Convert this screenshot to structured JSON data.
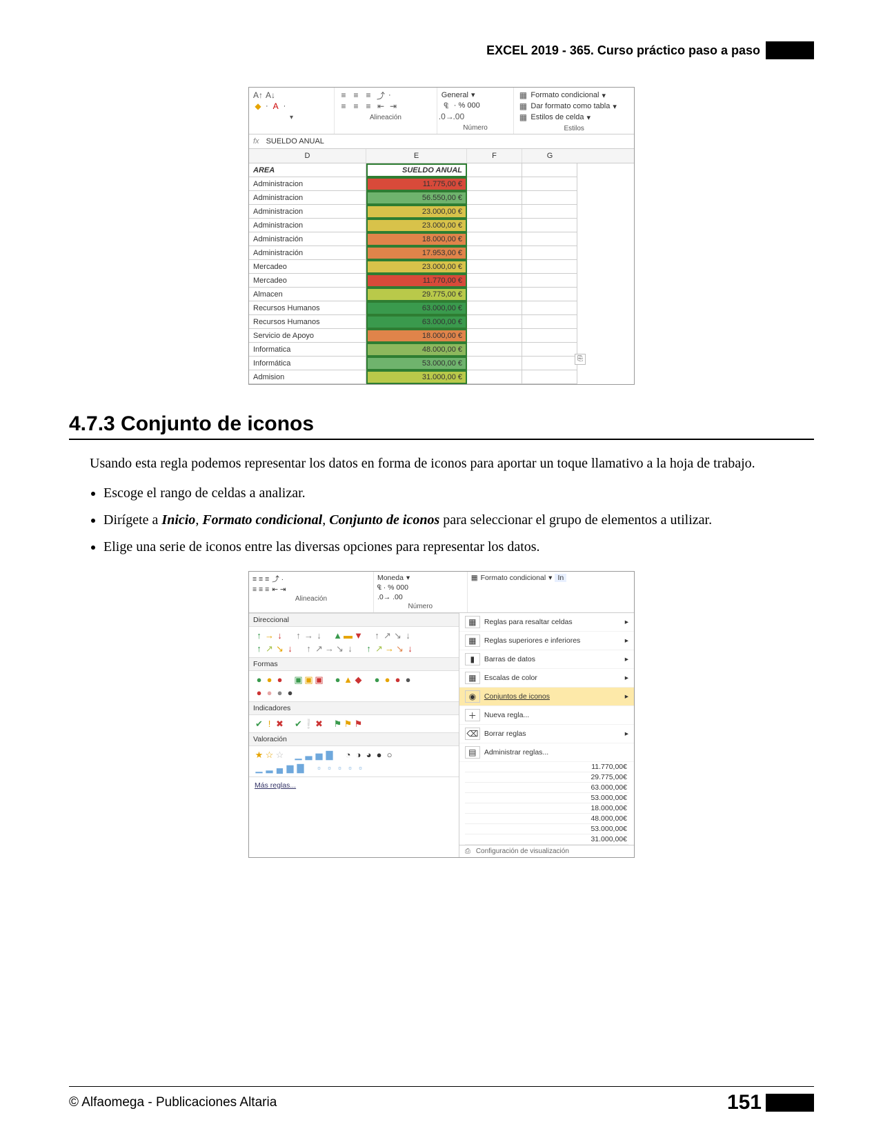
{
  "header": {
    "title": "EXCEL 2019 - 365. Curso práctico paso a paso"
  },
  "figure1": {
    "ribbon": {
      "font_group": {},
      "alignment_label": "Alineación",
      "number_format": "General",
      "number_label": "Número",
      "styles_label": "Estilos",
      "btn_cond": "Formato condicional",
      "btn_table": "Dar formato como tabla",
      "btn_cell": "Estilos de celda"
    },
    "formula_bar": {
      "fx": "fx",
      "value": "SUELDO ANUAL"
    },
    "columns": {
      "d": "D",
      "e": "E",
      "f": "F",
      "g": "G"
    },
    "headers": {
      "area": "AREA",
      "sueldo": "SUELDO ANUAL"
    },
    "rows": [
      {
        "area": "Administracion",
        "val": "11.775,00 €",
        "color": "#d84a3a"
      },
      {
        "area": "Administracion",
        "val": "56.550,00 €",
        "color": "#6fb36d"
      },
      {
        "area": "Administracion",
        "val": "23.000,00 €",
        "color": "#d8c24a"
      },
      {
        "area": "Administracion",
        "val": "23.000,00 €",
        "color": "#d8c24a"
      },
      {
        "area": "Administración",
        "val": "18.000,00 €",
        "color": "#e0844a"
      },
      {
        "area": "Administración",
        "val": "17.953,00 €",
        "color": "#e0844a"
      },
      {
        "area": "Mercadeo",
        "val": "23.000,00 €",
        "color": "#d8c24a"
      },
      {
        "area": "Mercadeo",
        "val": "11.770,00 €",
        "color": "#d84a3a"
      },
      {
        "area": "Almacen",
        "val": "29.775,00 €",
        "color": "#b9c94a"
      },
      {
        "area": "Recursos Humanos",
        "val": "63.000,00 €",
        "color": "#3a9a4d"
      },
      {
        "area": "Recursos Humanos",
        "val": "63.000,00 €",
        "color": "#3a9a4d"
      },
      {
        "area": "Servicio de Apoyo",
        "val": "18.000,00 €",
        "color": "#e0844a"
      },
      {
        "area": "Informatica",
        "val": "48.000,00 €",
        "color": "#8db85d"
      },
      {
        "area": "Informática",
        "val": "53.000,00 €",
        "color": "#6fb36d"
      },
      {
        "area": "Admision",
        "val": "31.000,00 €",
        "color": "#b9c94a"
      }
    ]
  },
  "section": {
    "number_title": "4.7.3 Conjunto de iconos",
    "para1": "Usando esta regla podemos representar los datos en forma de iconos para aportar un toque llamativo a la hoja de trabajo.",
    "bullet1": "Escoge el rango de celdas a analizar.",
    "bullet2_a": "Dirígete a ",
    "bullet2_b1": "Inicio",
    "bullet2_b2": "Formato condicional",
    "bullet2_b3": "Conjunto de iconos",
    "bullet2_c": " para seleccionar el grupo de elementos a utilizar.",
    "bullet3": "Elige una serie de iconos entre las diversas opciones para representar los datos."
  },
  "figure2": {
    "ribbon": {
      "alignment_label": "Alineación",
      "number_format": "Moneda",
      "number_label": "Número",
      "btn_cond": "Formato condicional",
      "btn_ins": "In"
    },
    "menu": {
      "highlight": "Reglas para resaltar celdas",
      "toprules": "Reglas superiores e inferiores",
      "databars": "Barras de datos",
      "colorscales": "Escalas de color",
      "iconsets": "Conjuntos de iconos",
      "newrule": "Nueva regla...",
      "clear": "Borrar reglas",
      "manage": "Administrar reglas..."
    },
    "gallery": {
      "dir": "Direccional",
      "shapes": "Formas",
      "indicators": "Indicadores",
      "rating": "Valoración",
      "more": "Más reglas..."
    },
    "sample_values": [
      "11.770,00€",
      "29.775,00€",
      "63.000,00€",
      "53.000,00€",
      "18.000,00€",
      "48.000,00€",
      "53.000,00€",
      "31.000,00€"
    ],
    "config_label": "Configuración de visualización"
  },
  "footer": {
    "copyright": "© Alfaomega - Publicaciones Altaria",
    "page": "151"
  }
}
